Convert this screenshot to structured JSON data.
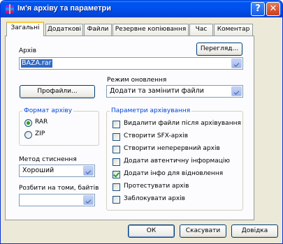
{
  "window": {
    "title": "Ім'я архіву та параметри"
  },
  "tabs": [
    {
      "label": "Загальні",
      "active": true
    },
    {
      "label": "Додаткові",
      "active": false
    },
    {
      "label": "Файли",
      "active": false
    },
    {
      "label": "Резервне копіювання",
      "active": false
    },
    {
      "label": "Час",
      "active": false
    },
    {
      "label": "Коментар",
      "active": false
    }
  ],
  "archive": {
    "label": "Архів",
    "value": "BAZA.rar",
    "browse_label": "Перегляд..."
  },
  "update_mode": {
    "label": "Режим оновлення",
    "value": "Додати та замінити файли"
  },
  "profiles_label": "Профайли...",
  "format": {
    "title": "Формат архіву",
    "options": [
      {
        "label": "RAR",
        "selected": true
      },
      {
        "label": "ZIP",
        "selected": false
      }
    ]
  },
  "params": {
    "title": "Параметри архівування",
    "options": [
      {
        "label": "Видалити файли після архівування",
        "checked": false
      },
      {
        "label": "Створити SFX-архів",
        "checked": false
      },
      {
        "label": "Створити неперервний архів",
        "checked": false
      },
      {
        "label": "Додати автентичну інформацію",
        "checked": false
      },
      {
        "label": "Додати інфо для відновлення",
        "checked": true
      },
      {
        "label": "Протестувати архів",
        "checked": false
      },
      {
        "label": "Заблокувати архів",
        "checked": false
      }
    ]
  },
  "compression": {
    "label": "Метод стиснення",
    "value": "Хороший"
  },
  "split": {
    "label": "Розбити на томи, байтів",
    "value": ""
  },
  "buttons": {
    "ok": "ОК",
    "cancel": "Скасувати",
    "help": "Довідка"
  }
}
